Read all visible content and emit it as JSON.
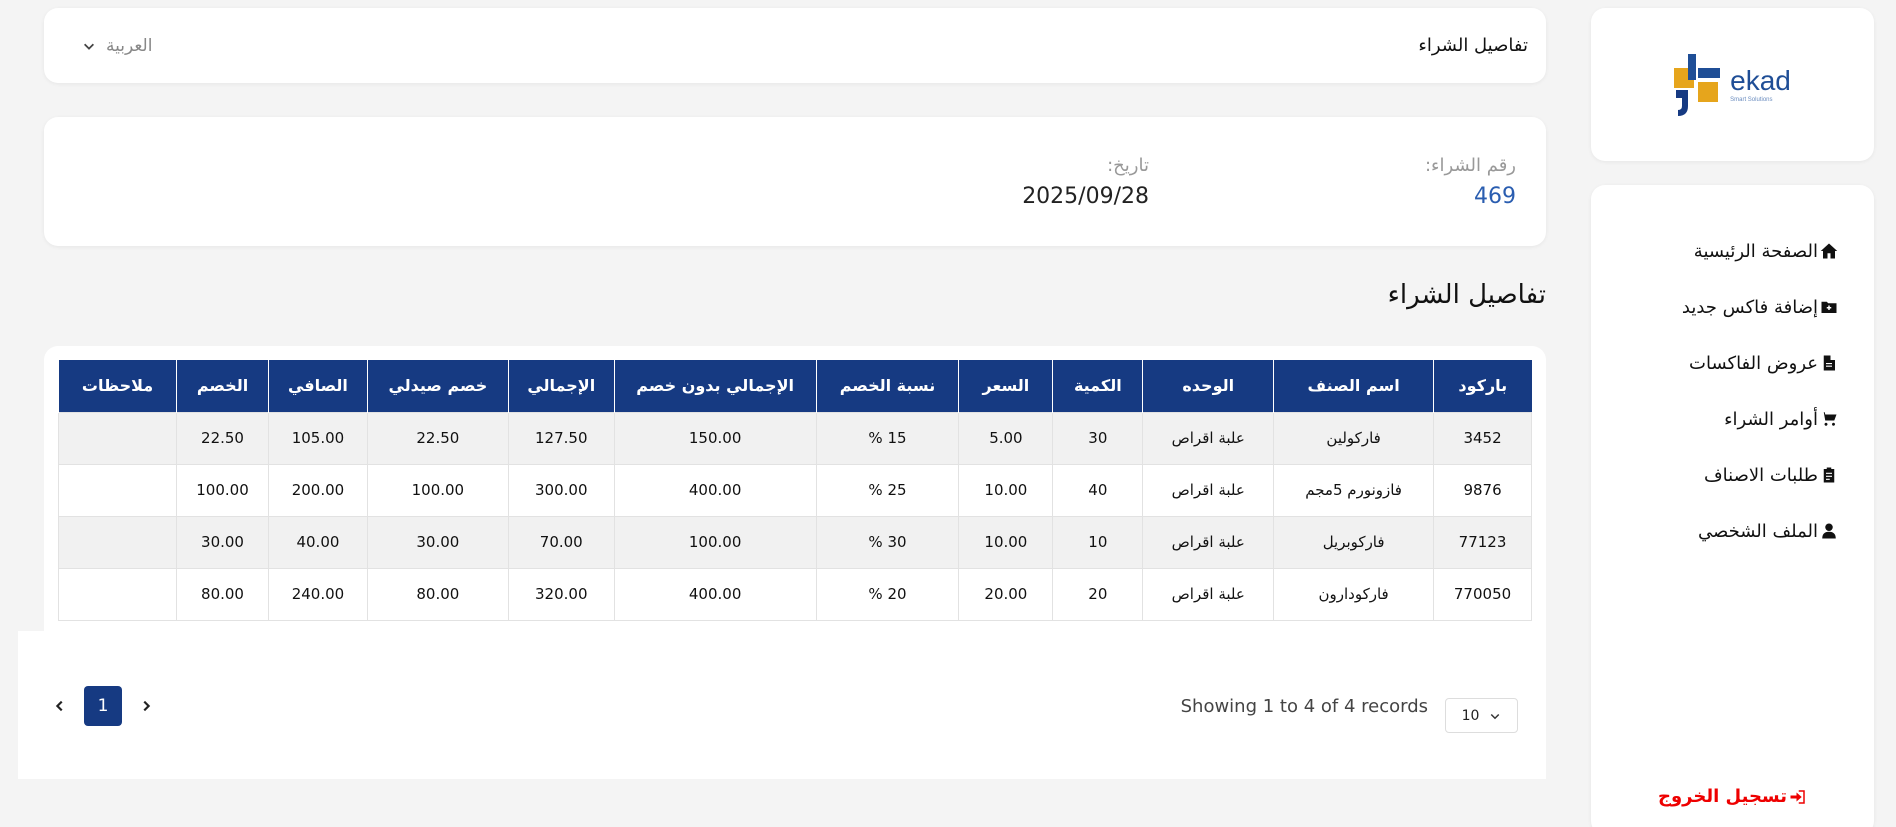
{
  "brand": {
    "name": "ekad",
    "tagline": "Smart Solutions",
    "primary_color": "#163a82",
    "accent_color": "#e6a51c"
  },
  "sidebar": {
    "items": [
      {
        "label": "الصفحة الرئيسية",
        "icon": "home-icon"
      },
      {
        "label": "إضافة فاكس جديد",
        "icon": "folder-plus-icon"
      },
      {
        "label": "عروض الفاكسات",
        "icon": "file-icon"
      },
      {
        "label": "أوامر الشراء",
        "icon": "cart-icon"
      },
      {
        "label": "طلبات الاصناف",
        "icon": "clipboard-icon"
      },
      {
        "label": "الملف الشخصي",
        "icon": "user-icon"
      }
    ],
    "logout": "تسجيل الخروج"
  },
  "header": {
    "title": "تفاصيل الشراء",
    "language": "العربية"
  },
  "info": {
    "purchase_number_label": "رقم الشراء:",
    "purchase_number": "469",
    "date_label": "تاريخ:",
    "date": "2025/09/28"
  },
  "section_title": "تفاصيل الشراء",
  "table": {
    "headers": [
      "باركود",
      "اسم الصنف",
      "الوحده",
      "الكمية",
      "السعر",
      "نسبة الخصم",
      "الإجمالي بدون خصم",
      "الإجمالي",
      "خصم صيدلي",
      "الصافي",
      "الخصم",
      "ملاحظات"
    ],
    "rows": [
      [
        "3452",
        "فاركولين",
        "علبة اقراص",
        "30",
        "5.00",
        "15 %",
        "150.00",
        "127.50",
        "22.50",
        "105.00",
        "22.50",
        ""
      ],
      [
        "9876",
        "فازونورم 5مجم",
        "علبة اقراص",
        "40",
        "10.00",
        "25 %",
        "400.00",
        "300.00",
        "100.00",
        "200.00",
        "100.00",
        ""
      ],
      [
        "77123",
        "فاركوبريل",
        "علبة اقراص",
        "10",
        "10.00",
        "30 %",
        "100.00",
        "70.00",
        "30.00",
        "40.00",
        "30.00",
        ""
      ],
      [
        "770050",
        "فاركودارون",
        "علبة اقراص",
        "20",
        "20.00",
        "20 %",
        "400.00",
        "320.00",
        "80.00",
        "240.00",
        "80.00",
        ""
      ]
    ]
  },
  "footer": {
    "page_size": "10",
    "showing": "Showing 1 to 4 of 4 records",
    "current_page": "1"
  }
}
